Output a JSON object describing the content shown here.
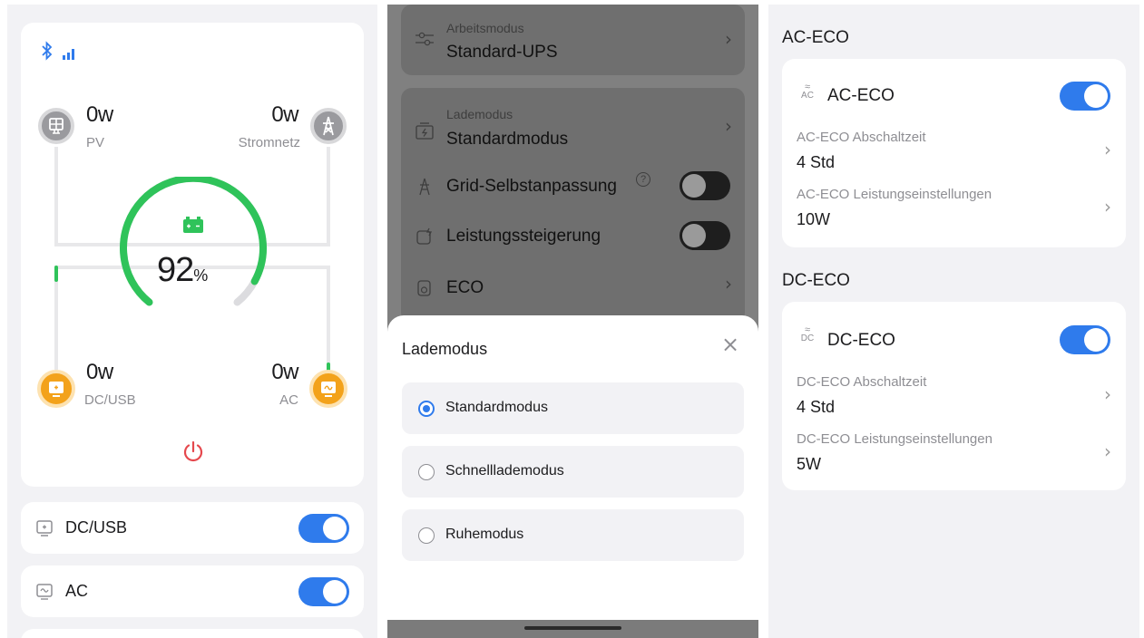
{
  "left_panel": {
    "pv": {
      "value": "0w",
      "label": "PV"
    },
    "grid": {
      "value": "0w",
      "label": "Stromnetz"
    },
    "battery": {
      "percent": "92",
      "unit": "%",
      "fill_fraction": 0.92
    },
    "dcusb": {
      "value": "0w",
      "label": "DC/USB"
    },
    "ac": {
      "value": "0w",
      "label": "AC"
    },
    "rows": [
      {
        "label": "DC/USB",
        "on": true
      },
      {
        "label": "AC",
        "on": true
      }
    ],
    "colors": {
      "accent_green": "#2fc35a",
      "orange": "#f3a21b",
      "toggle_blue": "#2f7bec",
      "power_red": "#e5484d"
    }
  },
  "middle_panel": {
    "arbeitsmodus": {
      "label": "Arbeitsmodus",
      "value": "Standard-UPS"
    },
    "lademodus_row": {
      "label": "Lademodus",
      "value": "Standardmodus"
    },
    "grid_adapt": {
      "label": "Grid-Selbstanpassung",
      "help": "?"
    },
    "boost": {
      "label": "Leistungssteigerung"
    },
    "eco": {
      "label": "ECO"
    },
    "sheet": {
      "title": "Lademodus",
      "close": "×",
      "options": [
        {
          "label": "Standardmodus",
          "selected": true
        },
        {
          "label": "Schnelllademodus",
          "selected": false
        },
        {
          "label": "Ruhemodus",
          "selected": false
        }
      ]
    }
  },
  "right_panel": {
    "ac_section": {
      "section_title": "AC-ECO",
      "title": "AC-ECO",
      "icon_text": "AC",
      "enabled": true,
      "shutdown_label": "AC-ECO Abschaltzeit",
      "shutdown_value": "4 Std",
      "power_label": "AC-ECO Leistungseinstellungen",
      "power_value": "10W"
    },
    "dc_section": {
      "section_title": "DC-ECO",
      "title": "DC-ECO",
      "icon_text": "DC",
      "enabled": true,
      "shutdown_label": "DC-ECO Abschaltzeit",
      "shutdown_value": "4 Std",
      "power_label": "DC-ECO Leistungseinstellungen",
      "power_value": "5W"
    }
  }
}
